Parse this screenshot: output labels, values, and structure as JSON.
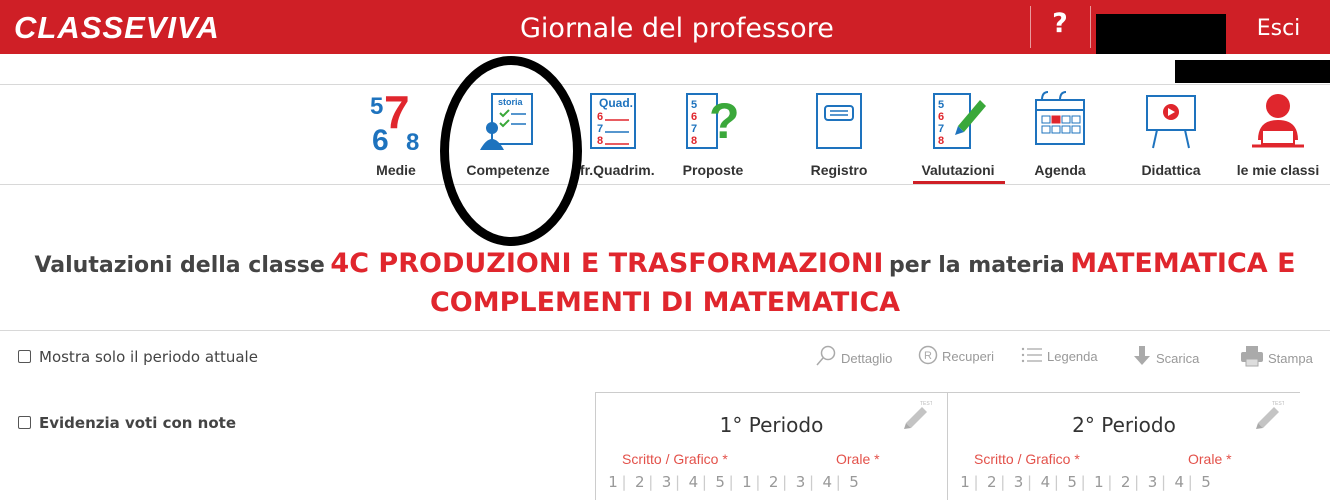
{
  "topbar": {
    "logo": "CLASSEVIVA",
    "title": "Giornale del professore",
    "help": "?",
    "logout": "Esci"
  },
  "nav": [
    {
      "label": "Medie",
      "icon": "numbers-678-icon"
    },
    {
      "label": "Competenze",
      "icon": "competence-sheet-icon"
    },
    {
      "label": "nfr.Quadrim.",
      "icon": "quad-grades-icon"
    },
    {
      "label": "Proposte",
      "icon": "question-grades-icon"
    },
    {
      "label": "Registro",
      "icon": "register-book-icon"
    },
    {
      "label": "Valutazioni",
      "icon": "grades-pen-icon",
      "active": true
    },
    {
      "label": "Agenda",
      "icon": "calendar-icon"
    },
    {
      "label": "Didattica",
      "icon": "presentation-board-icon"
    },
    {
      "label": "le mie classi",
      "icon": "user-at-desk-icon"
    }
  ],
  "heading": {
    "prefix": "Valutazioni della classe",
    "classname": "4C PRODUZIONI E TRASFORMAZIONI",
    "middle": "per la materia",
    "subject_line1": "MATEMATICA E",
    "subject_line2": "COMPLEMENTI DI MATEMATICA"
  },
  "options": {
    "current_period_only": "Mostra solo il periodo attuale",
    "highlight_notes": "Evidenzia voti con note"
  },
  "toolbar": {
    "detail": "Dettaglio",
    "recoveries": "Recuperi",
    "legend": "Legenda",
    "download": "Scarica",
    "print": "Stampa"
  },
  "periods": [
    {
      "title": "1° Periodo",
      "written": "Scritto / Grafico *",
      "oral": "Orale *",
      "written_cols": [
        "1",
        "2",
        "3",
        "4",
        "5"
      ],
      "oral_cols": [
        "1",
        "2",
        "3",
        "4",
        "5"
      ]
    },
    {
      "title": "2° Periodo",
      "written": "Scritto / Grafico *",
      "oral": "Orale *",
      "written_cols": [
        "1",
        "2",
        "3",
        "4",
        "5"
      ],
      "oral_cols": [
        "1",
        "2",
        "3",
        "4",
        "5"
      ]
    }
  ],
  "colors": {
    "brand_red": "#cf1f26",
    "heading_red": "#e0262d",
    "sub_red": "#e3514a"
  }
}
